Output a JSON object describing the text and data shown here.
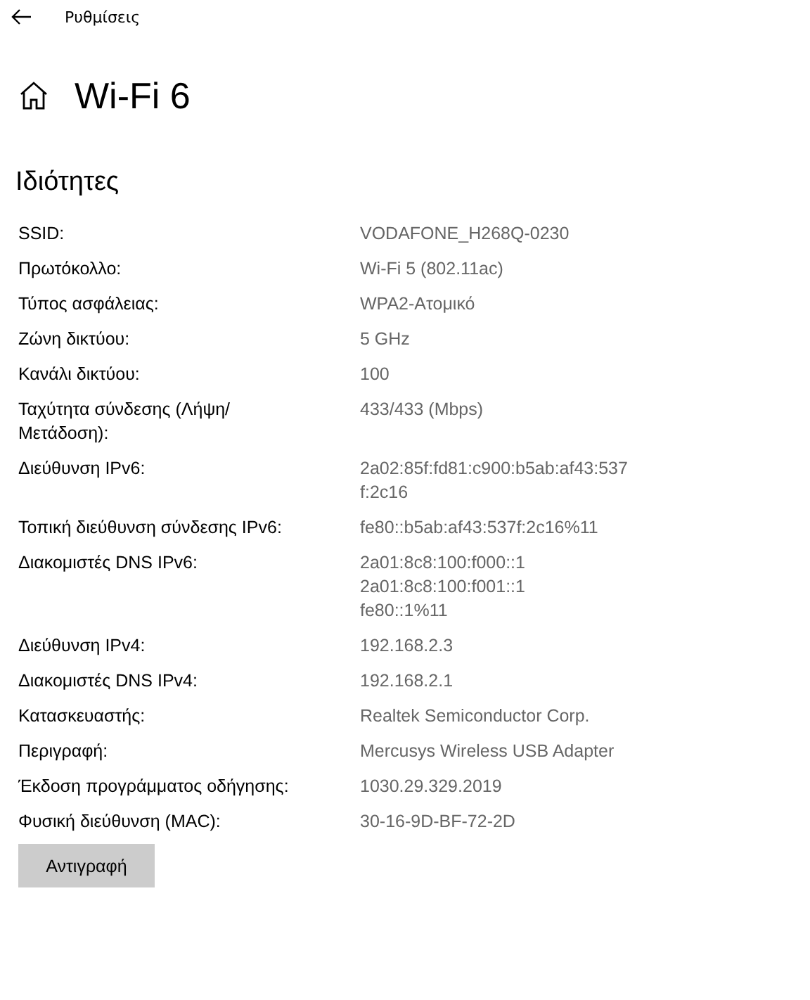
{
  "window": {
    "title": "Ρυθμίσεις"
  },
  "page": {
    "title": "Wi-Fi 6"
  },
  "section": {
    "title": "Ιδιότητες"
  },
  "properties": [
    {
      "label": [
        "SSID:"
      ],
      "value": [
        "VODAFONE_H268Q-0230"
      ]
    },
    {
      "label": [
        "Πρωτόκολλο:"
      ],
      "value": [
        "Wi-Fi 5 (802.11ac)"
      ]
    },
    {
      "label": [
        "Τύπος ασφάλειας:"
      ],
      "value": [
        "WPA2-Ατομικό"
      ]
    },
    {
      "label": [
        "Ζώνη δικτύου:"
      ],
      "value": [
        "5 GHz"
      ]
    },
    {
      "label": [
        "Κανάλι δικτύου:"
      ],
      "value": [
        "100"
      ]
    },
    {
      "label": [
        "Ταχύτητα σύνδεσης (Λήψη/",
        "Μετάδοση):"
      ],
      "value": [
        "433/433 (Mbps)"
      ]
    },
    {
      "label": [
        "Διεύθυνση IPv6:"
      ],
      "value": [
        "2a02:85f:fd81:c900:b5ab:af43:537",
        "f:2c16"
      ]
    },
    {
      "label": [
        "Τοπική διεύθυνση σύνδεσης IPv6:"
      ],
      "value": [
        "fe80::b5ab:af43:537f:2c16%11"
      ]
    },
    {
      "label": [
        "Διακομιστές DNS IPv6:"
      ],
      "value": [
        "2a01:8c8:100:f000::1",
        "2a01:8c8:100:f001::1",
        "fe80::1%11"
      ]
    },
    {
      "label": [
        "Διεύθυνση IPv4:"
      ],
      "value": [
        "192.168.2.3"
      ]
    },
    {
      "label": [
        "Διακομιστές DNS IPv4:"
      ],
      "value": [
        "192.168.2.1"
      ]
    },
    {
      "label": [
        "Κατασκευαστής:"
      ],
      "value": [
        "Realtek Semiconductor Corp."
      ]
    },
    {
      "label": [
        "Περιγραφή:"
      ],
      "value": [
        "Mercusys Wireless USB Adapter"
      ]
    },
    {
      "label": [
        "Έκδοση προγράμματος οδήγησης:"
      ],
      "value": [
        "1030.29.329.2019"
      ]
    },
    {
      "label": [
        "Φυσική διεύθυνση (MAC):"
      ],
      "value": [
        "30-16-9D-BF-72-2D"
      ]
    }
  ],
  "copy_button": {
    "label": "Αντιγραφή"
  }
}
